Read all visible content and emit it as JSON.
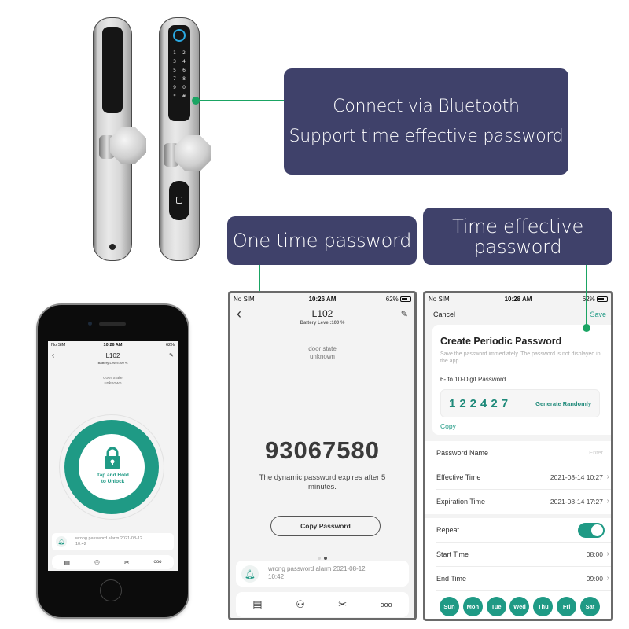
{
  "callouts": {
    "bluetooth": {
      "line1": "Connect via Bluetooth",
      "line2": "Support time effective password"
    },
    "one_time": {
      "label": "One time password"
    },
    "time_effective": {
      "line1": "Time effective",
      "line2": "password"
    }
  },
  "colors": {
    "callout_bg": "#3f416a",
    "leader": "#1aa463",
    "accent": "#1f9a85"
  },
  "home_screen": {
    "status": {
      "carrier": "No SIM",
      "time": "10:26 AM",
      "battery": "62%"
    },
    "title": "L102",
    "battery_level": "Battery Level:100 %",
    "door_state": [
      "door state",
      "unknown"
    ],
    "unlock_label": [
      "Tap and Hold",
      "to Unlock"
    ],
    "page_dots": {
      "count": 2,
      "active": 0
    },
    "alarm": {
      "text": "wrong password alarm 2021-08-12",
      "time": "10:42"
    },
    "tabs": [
      {
        "icon": "records-icon"
      },
      {
        "icon": "user-icon"
      },
      {
        "icon": "tools-icon"
      },
      {
        "icon": "more-icon",
        "glyph": "ooo"
      }
    ]
  },
  "otp_screen": {
    "status": {
      "carrier": "No SIM",
      "time": "10:26 AM",
      "battery": "62%"
    },
    "title": "L102",
    "battery_level": "Battery Level:100 %",
    "door_state": [
      "door state",
      "unknown"
    ],
    "password": "93067580",
    "message": "The dynamic password expires after 5 minutes.",
    "copy_button": "Copy Password",
    "page_dots": {
      "count": 2,
      "active": 1
    },
    "alarm": {
      "text": "wrong password alarm 2021-08-12",
      "time": "10:42"
    },
    "tabs": [
      {
        "icon": "records-icon"
      },
      {
        "icon": "user-icon"
      },
      {
        "icon": "tools-icon"
      },
      {
        "icon": "more-icon",
        "glyph": "ooo"
      }
    ]
  },
  "periodic_screen": {
    "status": {
      "carrier": "No SIM",
      "time": "10:28 AM",
      "battery": "62%"
    },
    "cancel": "Cancel",
    "save": "Save",
    "title": "Create Periodic Password",
    "description": "Save the password immediately. The password is not displayed in the app.",
    "password_label": "6- to 10-Digit Password",
    "password": "122427",
    "generate": "Generate Randomly",
    "copy": "Copy",
    "rows1": [
      {
        "label": "Password Name",
        "value": "",
        "placeholder": "Enter"
      },
      {
        "label": "Effective Time",
        "value": "2021-08-14 10:27"
      },
      {
        "label": "Expiration Time",
        "value": "2021-08-14 17:27"
      }
    ],
    "repeat": {
      "label": "Repeat",
      "on": true
    },
    "rows2": [
      {
        "label": "Start Time",
        "value": "08:00"
      },
      {
        "label": "End Time",
        "value": "09:00"
      }
    ],
    "days": [
      "Sun",
      "Mon",
      "Tue",
      "Wed",
      "Thu",
      "Fri",
      "Sat"
    ]
  }
}
